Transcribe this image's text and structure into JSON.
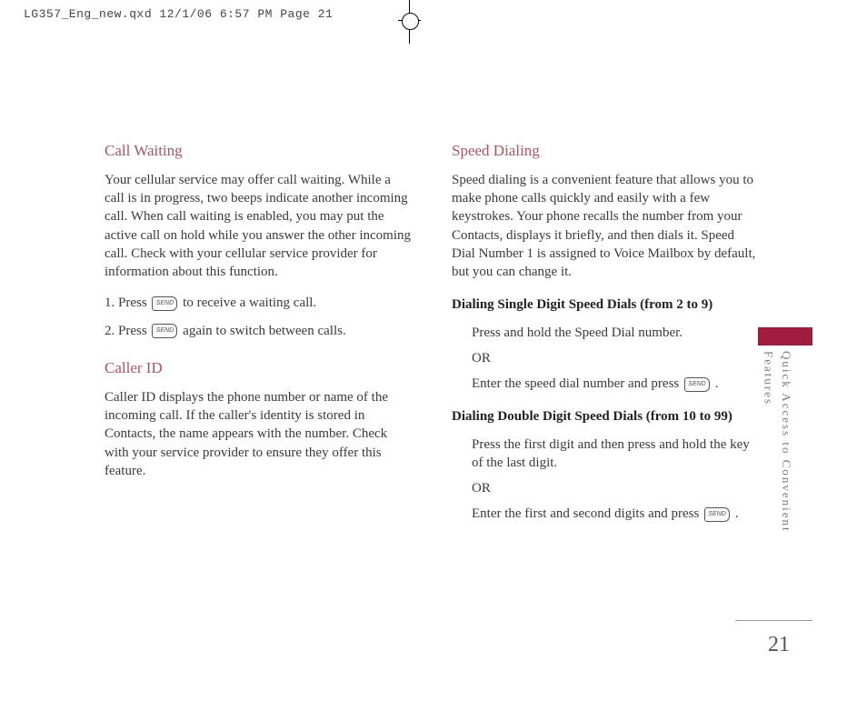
{
  "crop": {
    "header": "LG357_Eng_new.qxd  12/1/06  6:57 PM  Page 21"
  },
  "left_column": {
    "section1": {
      "heading": "Call Waiting",
      "body": "Your cellular service may offer call waiting. While a call is in progress, two beeps indicate another incoming call. When call waiting is enabled, you may put the active call on hold while you answer the other incoming call. Check with your cellular service provider for information about this function.",
      "step1_a": "1. Press ",
      "step1_b": " to receive a waiting call.",
      "step2_a": "2. Press ",
      "step2_b": " again to switch between calls."
    },
    "section2": {
      "heading": "Caller ID",
      "body": "Caller ID displays the phone number or name of the incoming call. If the caller's identity is stored in Contacts, the name appears with the number. Check with your service provider to ensure they offer this feature."
    }
  },
  "right_column": {
    "section1": {
      "heading": "Speed Dialing",
      "body": "Speed dialing is a convenient feature that allows you to make phone calls quickly and easily with a few keystrokes. Your phone recalls the number from your Contacts, displays it briefly, and then dials it. Speed Dial Number 1 is assigned to Voice Mailbox by default, but you can change it.",
      "sub1": {
        "title": "Dialing Single Digit Speed Dials (from 2 to 9)",
        "line1": "Press and hold the Speed Dial number.",
        "or": "OR",
        "line2_a": "Enter the speed dial number and press ",
        "line2_b": "."
      },
      "sub2": {
        "title": "Dialing Double Digit Speed Dials (from 10 to 99)",
        "line1": "Press the first digit and then press and hold the key of the last digit.",
        "or": "OR",
        "line2_a": "Enter the first and second digits and press ",
        "line2_b": "."
      }
    }
  },
  "side": {
    "text": "Quick Access to Convenient Features"
  },
  "icons": {
    "send": "SEND"
  },
  "page_number": "21"
}
